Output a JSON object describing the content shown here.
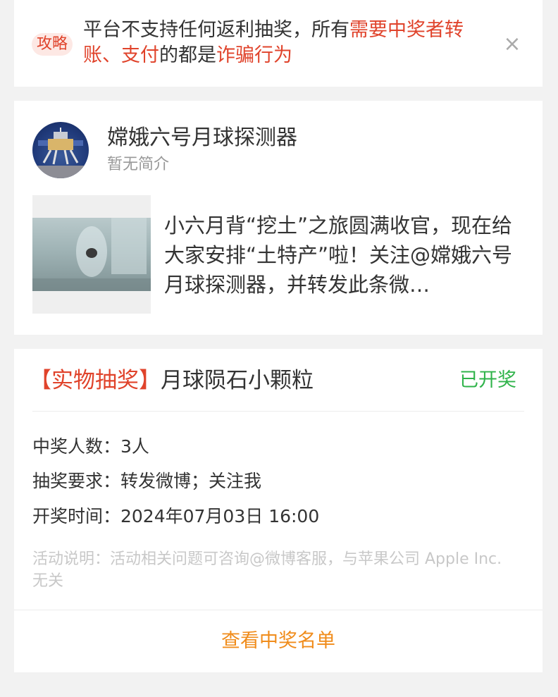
{
  "notice": {
    "tag": "攻略",
    "text_part1": "平台不支持任何返利抽奖，所有",
    "text_highlight1": "需要中奖者转账、支付",
    "text_part2": "的都是",
    "text_highlight2": "诈骗行为",
    "close_glyph": "×"
  },
  "profile": {
    "name": "嫦娥六号月球探测器",
    "bio": "暂无简介",
    "post_text": "小六月背“挖土”之旅圆满收官，现在给大家安排“土特产”啦！关注@嫦娥六号月球探测器，并转发此条微…"
  },
  "lottery": {
    "prize_type": "【实物抽奖】",
    "prize_name": "月球陨石小颗粒",
    "status": "已开奖",
    "winners_count": "中奖人数：3人",
    "requirements": "抽奖要求：转发微博；关注我",
    "draw_time": "开奖时间：2024年07月03日 16:00",
    "description": "活动说明：活动相关问题可咨询@微博客服，与苹果公司 Apple Inc. 无关",
    "view_winners": "查看中奖名单"
  },
  "colors": {
    "highlight_red": "#e0432b",
    "status_green": "#2fb34a",
    "action_orange": "#f08c1b"
  }
}
